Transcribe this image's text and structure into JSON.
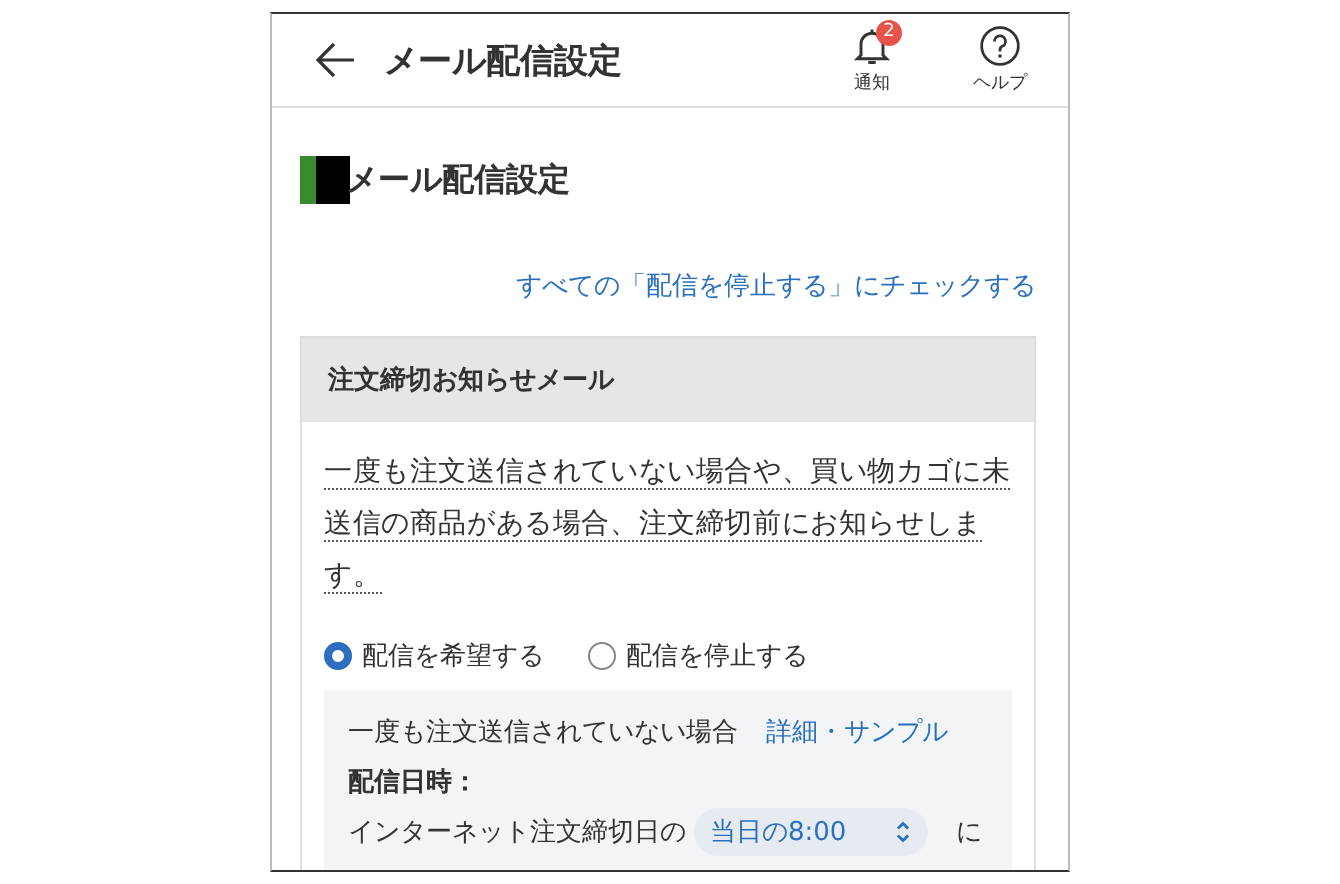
{
  "header": {
    "title": "メール配信設定",
    "actions": [
      {
        "kind": "bell",
        "label": "通知",
        "badge": "2"
      },
      {
        "kind": "help",
        "label": "ヘルプ"
      }
    ]
  },
  "heading": "メール配信設定",
  "stop_all_link": "すべての「配信を停止する」にチェックする",
  "card": {
    "title": "注文締切お知らせメール",
    "description": "一度も注文送信されていない場合や、買い物カゴに未送信の商品がある場合、注文締切前にお知らせします。",
    "options": [
      {
        "label": "配信を希望する",
        "selected": true
      },
      {
        "label": "配信を停止する",
        "selected": false
      }
    ],
    "detail": {
      "condition": "一度も注文送信されていない場合",
      "sample_link": "詳細・サンプル",
      "time_label": "配信日時：",
      "time_prefix": "インターネット注文締切日の",
      "time_value": "当日の8:00",
      "time_suffix": "に"
    }
  }
}
